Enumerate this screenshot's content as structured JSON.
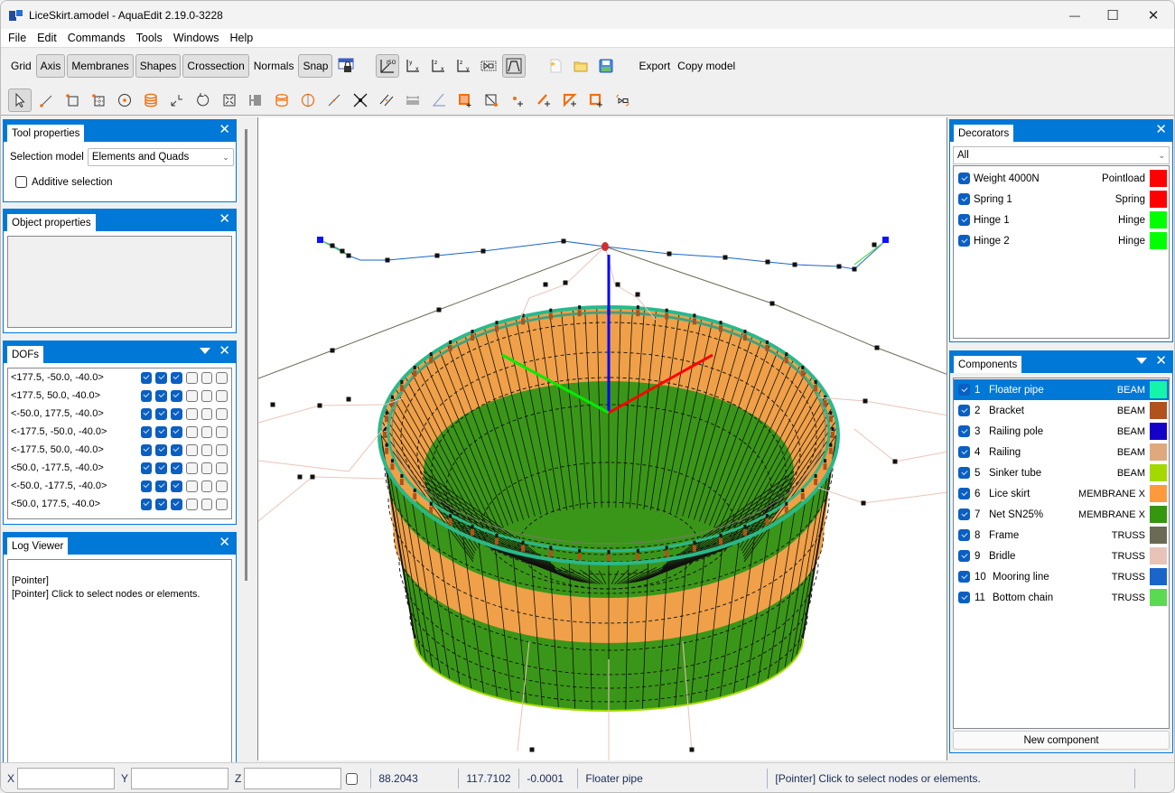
{
  "window": {
    "title": "LiceSkirt.amodel - AquaEdit 2.19.0-3228",
    "controls": {
      "minimize": "—",
      "maximize": "☐",
      "close": "✕"
    }
  },
  "menubar": [
    "File",
    "Edit",
    "Commands",
    "Tools",
    "Windows",
    "Help"
  ],
  "toolbar1": {
    "grid": "Grid",
    "axis": "Axis",
    "membranes": "Membranes",
    "shapes": "Shapes",
    "crossection": "Crossection",
    "normals": "Normals",
    "snap": "Snap",
    "view_icons": [
      "lock-view-icon",
      "iso-view-icon",
      "xy-view-icon",
      "xz-view-icon",
      "yz-view-icon",
      "fit-view-icon",
      "perspective-icon"
    ],
    "iso_label": "ISO",
    "file_icons": [
      "new-file-icon",
      "open-folder-icon",
      "save-icon"
    ],
    "export": "Export",
    "copy_model": "Copy model"
  },
  "toolbar2": {
    "tools": [
      "pointer-icon",
      "add-line-icon",
      "add-rectangle-icon",
      "add-grid-icon",
      "add-circle-icon",
      "add-cylinder-icon",
      "move-icon",
      "rotate-icon",
      "scale-icon",
      "array-icon",
      "cylinder-outline-icon",
      "sphere-icon",
      "line-icon",
      "split-icon",
      "parallel-icon",
      "measure-icon",
      "angle-icon",
      "add-quad-icon",
      "add-triangle-element-icon",
      "add-node-icon",
      "add-beam-icon",
      "add-tri-icon",
      "add-quad-outline-icon",
      "decorator-icon"
    ]
  },
  "tool_properties": {
    "title": "Tool properties",
    "selection_model_label": "Selection model",
    "selection_model_value": "Elements and Quads",
    "additive_selection_label": "Additive selection",
    "additive_selection_checked": false
  },
  "object_properties": {
    "title": "Object properties"
  },
  "dofs": {
    "title": "DOFs",
    "rows": [
      {
        "label": "<177.5, -50.0, -40.0>",
        "flags": [
          true,
          true,
          true,
          false,
          false,
          false
        ]
      },
      {
        "label": "<177.5, 50.0, -40.0>",
        "flags": [
          true,
          true,
          true,
          false,
          false,
          false
        ]
      },
      {
        "label": "<-50.0, 177.5, -40.0>",
        "flags": [
          true,
          true,
          true,
          false,
          false,
          false
        ]
      },
      {
        "label": "<-177.5, -50.0, -40.0>",
        "flags": [
          true,
          true,
          true,
          false,
          false,
          false
        ]
      },
      {
        "label": "<-177.5, 50.0, -40.0>",
        "flags": [
          true,
          true,
          true,
          false,
          false,
          false
        ]
      },
      {
        "label": "<50.0, -177.5, -40.0>",
        "flags": [
          true,
          true,
          true,
          false,
          false,
          false
        ]
      },
      {
        "label": "<-50.0, -177.5, -40.0>",
        "flags": [
          true,
          true,
          true,
          false,
          false,
          false
        ]
      },
      {
        "label": "<50.0, 177.5, -40.0>",
        "flags": [
          true,
          true,
          true,
          false,
          false,
          false
        ]
      }
    ]
  },
  "log_viewer": {
    "title": "Log Viewer",
    "lines": [
      "[Pointer]",
      "[Pointer] Click to select nodes or elements."
    ]
  },
  "decorators": {
    "title": "Decorators",
    "filter": "All",
    "items": [
      {
        "name": "Weight 4000N",
        "type": "Pointload",
        "color": "#ff0000",
        "checked": true
      },
      {
        "name": "Spring 1",
        "type": "Spring",
        "color": "#ff0000",
        "checked": true
      },
      {
        "name": "Hinge 1",
        "type": "Hinge",
        "color": "#00ff00",
        "checked": true
      },
      {
        "name": "Hinge 2",
        "type": "Hinge",
        "color": "#00ff00",
        "checked": true
      }
    ]
  },
  "components": {
    "title": "Components",
    "selected_index": 0,
    "items": [
      {
        "num": "1",
        "name": "Floater pipe",
        "type": "BEAM",
        "color": "#14f5a8",
        "checked": true
      },
      {
        "num": "2",
        "name": "Bracket",
        "type": "BEAM",
        "color": "#b0521c",
        "checked": true
      },
      {
        "num": "3",
        "name": "Railing pole",
        "type": "BEAM",
        "color": "#1400c8",
        "checked": true
      },
      {
        "num": "4",
        "name": "Railing",
        "type": "BEAM",
        "color": "#dfa97d",
        "checked": true
      },
      {
        "num": "5",
        "name": "Sinker tube",
        "type": "BEAM",
        "color": "#a3d900",
        "checked": true
      },
      {
        "num": "6",
        "name": "Lice skirt",
        "type": "MEMBRANE X",
        "color": "#ff9a3c",
        "checked": true
      },
      {
        "num": "7",
        "name": "Net SN25%",
        "type": "MEMBRANE X",
        "color": "#35960f",
        "checked": true
      },
      {
        "num": "8",
        "name": "Frame",
        "type": "TRUSS",
        "color": "#6b6b55",
        "checked": true
      },
      {
        "num": "9",
        "name": "Bridle",
        "type": "TRUSS",
        "color": "#e8c4b8",
        "checked": true
      },
      {
        "num": "10",
        "name": "Mooring line",
        "type": "TRUSS",
        "color": "#1a66c8",
        "checked": true
      },
      {
        "num": "11",
        "name": "Bottom chain",
        "type": "TRUSS",
        "color": "#5ada50",
        "checked": true
      }
    ],
    "new_component": "New component"
  },
  "statusbar": {
    "x_label": "X",
    "y_label": "Y",
    "z_label": "Z",
    "x_value": "",
    "y_value": "",
    "z_value": "",
    "lock_checked": false,
    "coord_x": "88.2043",
    "coord_y": "117.7102",
    "coord_z": "-0.0001",
    "component": "Floater pipe",
    "message": "[Pointer] Click to select nodes or elements."
  },
  "viewport": {
    "colors": {
      "lice_skirt": "#f0a048",
      "net": "#3a9618",
      "floater": "#2ab88a",
      "frame": "#6b6b55",
      "bridle": "#e8c4b8",
      "mooring": "#1a66c8",
      "chain": "#5ada50",
      "axis_x": "#ff0000",
      "axis_y": "#00ee00",
      "axis_z": "#0000ff"
    }
  }
}
